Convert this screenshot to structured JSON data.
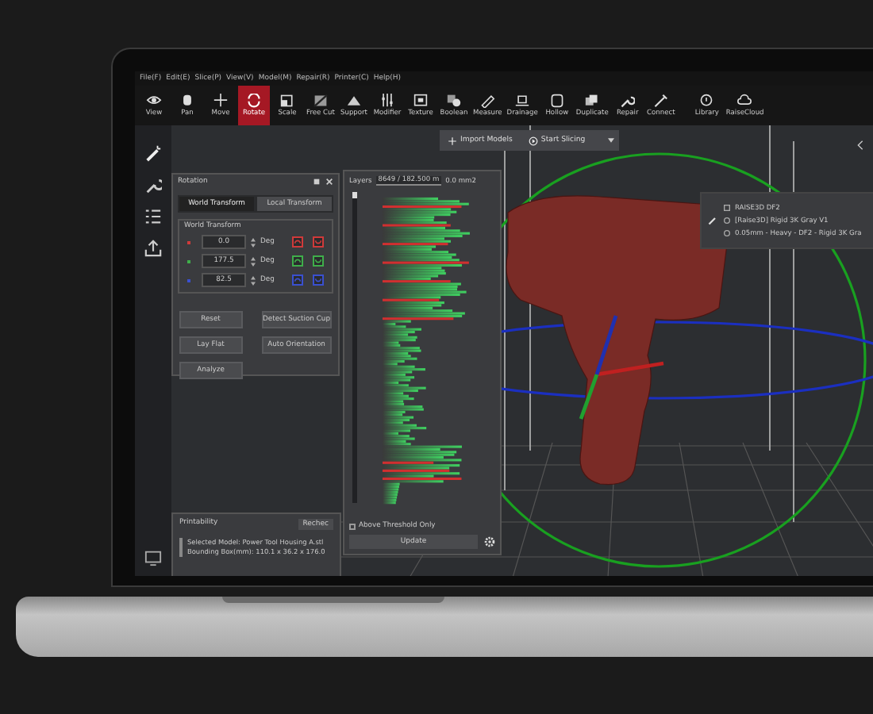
{
  "menu": [
    "File(F)",
    "Edit(E)",
    "Slice(P)",
    "View(V)",
    "Model(M)",
    "Repair(R)",
    "Printer(C)",
    "Help(H)"
  ],
  "toolbar": [
    {
      "label": "View",
      "selected": false
    },
    {
      "label": "Pan",
      "selected": false
    },
    {
      "label": "Move",
      "selected": false
    },
    {
      "label": "Rotate",
      "selected": true
    },
    {
      "label": "Scale",
      "selected": false
    },
    {
      "label": "Free Cut",
      "selected": false
    },
    {
      "label": "Support",
      "selected": false
    },
    {
      "label": "Modifier",
      "selected": false
    },
    {
      "label": "Texture",
      "selected": false
    },
    {
      "label": "Boolean",
      "selected": false
    },
    {
      "label": "Measure",
      "selected": false
    },
    {
      "label": "Drainage",
      "selected": false
    },
    {
      "label": "Hollow",
      "selected": false
    },
    {
      "label": "Duplicate",
      "selected": false
    },
    {
      "label": "Repair",
      "selected": false
    },
    {
      "label": "Connect",
      "selected": false
    },
    {
      "label": "Library",
      "selected": false
    },
    {
      "label": "RaiseCloud",
      "selected": false
    }
  ],
  "top_actions": [
    "Import Models",
    "Start Slicing"
  ],
  "rotation_panel": {
    "title": "Rotation",
    "tabs": [
      {
        "label": "World Transform",
        "selected": true
      },
      {
        "label": "Local Transform",
        "selected": false
      }
    ],
    "group": "World Transform",
    "axes": [
      {
        "value": "0.0",
        "unit": "Deg",
        "color": "#d03a3a"
      },
      {
        "value": "177.5",
        "unit": "Deg",
        "color": "#3fae4a"
      },
      {
        "value": "82.5",
        "unit": "Deg",
        "color": "#3a50d0"
      }
    ],
    "buttons": [
      "Reset",
      "Detect Suction Cup",
      "Lay Flat",
      "Auto Orientation",
      "Analyze"
    ]
  },
  "layers_panel": {
    "label": "Layers",
    "slider": {
      "level": 1
    },
    "layer_value": "8649 / 182.500 m",
    "area": "0.0 mm2",
    "threshold": {
      "label": "Above Threshold Only",
      "checked": false
    },
    "button": "Update"
  },
  "printer_panel": {
    "items": [
      "RAISE3D DF2",
      "[Raise3D] Rigid 3K Gray V1",
      "0.05mm - Heavy - DF2 - Rigid 3K Gra"
    ]
  },
  "printability": {
    "title": "Printability",
    "button": "Rechec",
    "lines": [
      "Selected Model: Power Tool Housing A.stl",
      "Bounding Box(mm): 110.1 x 36.2 x 176.0"
    ]
  }
}
